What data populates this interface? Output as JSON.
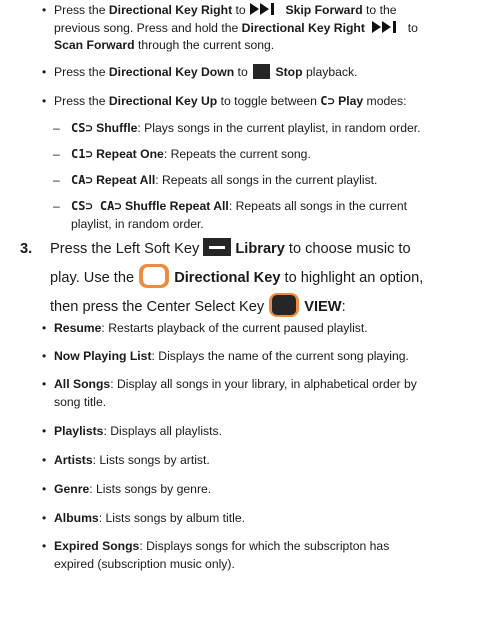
{
  "bullets_top": [
    {
      "parts": [
        "Press the ",
        "Directional Key Right",
        " to ",
        "",
        " Skip Forward",
        " to the"
      ],
      "line2": "previous song. Press and hold the ",
      "line2b": "Directional Key Right",
      "line2c": " to",
      "line3b": "Scan Forward",
      "line3c": " through the current song."
    },
    {
      "a": "Press the ",
      "b": "Directional Key Down",
      "c": " to ",
      "d": " Stop",
      "e": " playback."
    },
    {
      "a": "Press the ",
      "b": "Directional Key Up",
      "c": " to toggle between ",
      "icon": "C⊃",
      "d": " Play",
      "e": " modes:"
    }
  ],
  "modes": [
    {
      "icon": "CS⊃",
      "name": "Shuffle",
      "desc": ": Plays songs in the current playlist, in random order."
    },
    {
      "icon": "C1⊃",
      "name": "Repeat One",
      "desc": ": Repeats the current song."
    },
    {
      "icon": "CA⊃",
      "name": "Repeat All",
      "desc": ": Repeats all songs in the current playlist."
    },
    {
      "icon": "CS⊃ CA⊃",
      "name": "Shuffle Repeat All",
      "desc": ": Repeats all songs in the current",
      "desc2": "playlist, in random order."
    }
  ],
  "step3": {
    "num": "3.",
    "l1a": "Press the Left Soft Key ",
    "l1b": " Library",
    "l1c": " to choose music to",
    "l2a": "play. Use the ",
    "l2b": " Directional Key",
    "l2c": " to highlight an option,",
    "l3a": "then press the Center Select Key ",
    "l3b": " VIEW",
    "l3c": ":"
  },
  "options": [
    {
      "name": "Resume",
      "desc": ": Restarts playback of the current paused playlist."
    },
    {
      "name": "Now Playing List",
      "desc": ": Displays the name of the current song playing."
    },
    {
      "name": "All Songs",
      "desc": ": Display all songs in your library, in alphabetical order by",
      "desc2": "song title."
    },
    {
      "name": "Playlists",
      "desc": ": Displays all playlists."
    },
    {
      "name": "Artists",
      "desc": ": Lists songs by artist."
    },
    {
      "name": "Genre",
      "desc": ": Lists songs by genre."
    },
    {
      "name": "Albums",
      "desc": ": Lists songs by album title."
    },
    {
      "name": "Expired Songs",
      "desc": ": Displays songs for which the subscripton has",
      "desc2": "expired (subscription music only)."
    }
  ],
  "bullet_char": "•",
  "dash_char": "–",
  "colors": {
    "accent": "#f08a3c",
    "key_dark": "#262626"
  }
}
